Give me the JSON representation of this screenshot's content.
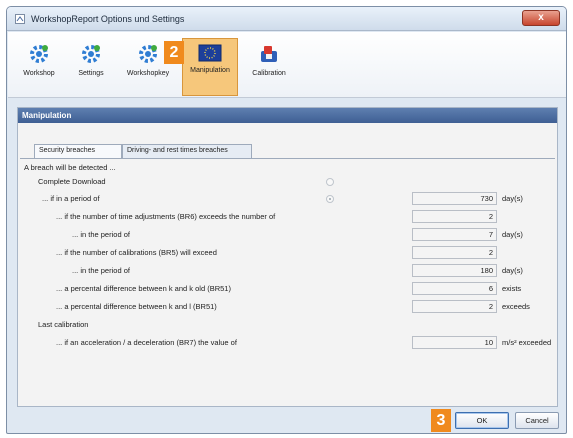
{
  "window": {
    "title": "WorkshopReport Options und Settings",
    "close_glyph": "x"
  },
  "toolbar": {
    "items": [
      {
        "label": "Workshop",
        "icon": "gear-icon",
        "active": false
      },
      {
        "label": "Settings",
        "icon": "gear-icon",
        "active": false
      },
      {
        "label": "Workshopkey",
        "icon": "gear-icon",
        "active": false
      },
      {
        "label": "Manipulation",
        "icon": "eu-flag-icon",
        "active": true
      },
      {
        "label": "Calibration",
        "icon": "calibration-icon",
        "active": false
      }
    ],
    "badge": "2"
  },
  "panel": {
    "title": "Manipulation",
    "tabs": [
      "Security breaches",
      "Driving- and rest times breaches"
    ]
  },
  "form": {
    "intro": "A breach will be detected ...",
    "complete_download": "Complete Download",
    "period": {
      "label": "... if in a period of",
      "value": "730",
      "unit": "day(s)"
    },
    "time_adjust": {
      "label": "... if the number of time adjustments (BR6) exceeds the number of",
      "value": "2"
    },
    "time_adjust_period": {
      "label": "... in the period of",
      "value": "7",
      "unit": "day(s)"
    },
    "calibrations": {
      "label": "... if the number of calibrations (BR5) will exceed",
      "value": "2"
    },
    "calibrations_period": {
      "label": "... in the period of",
      "value": "180",
      "unit": "day(s)"
    },
    "k_k_old": {
      "label": "... a percental difference between k and k old (BR51)",
      "value": "6",
      "unit": "exists"
    },
    "k_l": {
      "label": "... a percental difference between  k and l (BR51)",
      "value": "2",
      "unit": "exceeds"
    },
    "last_calibration": "Last calibration",
    "acceleration": {
      "label": "... if an acceleration / a deceleration (BR7) the value of",
      "value": "10",
      "unit": "m/s² exceeded"
    }
  },
  "buttons": {
    "badge": "3",
    "ok": "OK",
    "cancel": "Cancel"
  },
  "colors": {
    "accent_badge": "#f08a1d",
    "header_blue": "#4a6ba0",
    "active_tool": "#f6c77b"
  }
}
